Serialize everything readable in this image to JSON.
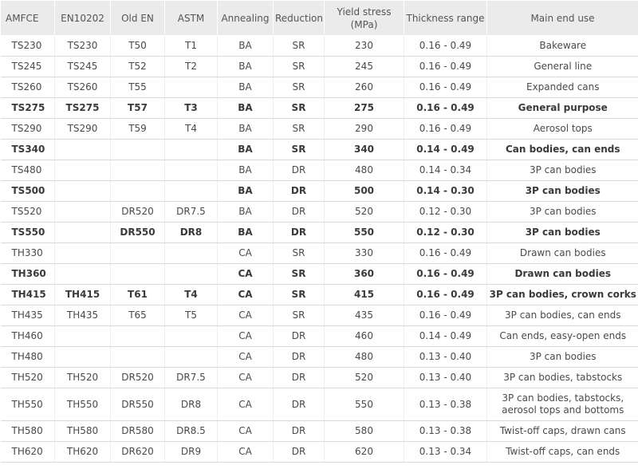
{
  "headers": [
    "AMFCE",
    "EN10202",
    "Old EN",
    "ASTM",
    "Annealing",
    "Reduction",
    "Yield stress (MPa)",
    "Thickness range",
    "Main end use"
  ],
  "rows": [
    [
      "TS230",
      "TS230",
      "T50",
      "T1",
      "BA",
      "SR",
      "230",
      "0.16 - 0.49",
      "Bakeware"
    ],
    [
      "TS245",
      "TS245",
      "T52",
      "T2",
      "BA",
      "SR",
      "245",
      "0.16 - 0.49",
      "General line"
    ],
    [
      "TS260",
      "TS260",
      "T55",
      "",
      "BA",
      "SR",
      "260",
      "0.16 - 0.49",
      "Expanded cans"
    ],
    [
      "TS275",
      "TS275",
      "T57",
      "T3",
      "BA",
      "SR",
      "275",
      "0.16 - 0.49",
      "General purpose"
    ],
    [
      "TS290",
      "TS290",
      "T59",
      "T4",
      "BA",
      "SR",
      "290",
      "0.16 - 0.49",
      "Aerosol tops"
    ],
    [
      "TS340",
      "",
      "",
      "",
      "BA",
      "SR",
      "340",
      "0.14 - 0.49",
      "Can bodies, can ends"
    ],
    [
      "TS480",
      "",
      "",
      "",
      "BA",
      "DR",
      "480",
      "0.14 - 0.34",
      "3P can bodies"
    ],
    [
      "TS500",
      "",
      "",
      "",
      "BA",
      "DR",
      "500",
      "0.14 - 0.30",
      "3P can bodies"
    ],
    [
      "TS520",
      "",
      "DR520",
      "DR7.5",
      "BA",
      "DR",
      "520",
      "0.12 - 0.30",
      "3P can bodies"
    ],
    [
      "TS550",
      "",
      "DR550",
      "DR8",
      "BA",
      "DR",
      "550",
      "0.12 - 0.30",
      "3P can bodies"
    ],
    [
      "TH330",
      "",
      "",
      "",
      "CA",
      "SR",
      "330",
      "0.16 - 0.49",
      "Drawn can bodies"
    ],
    [
      "TH360",
      "",
      "",
      "",
      "CA",
      "SR",
      "360",
      "0.16 - 0.49",
      "Drawn can bodies"
    ],
    [
      "TH415",
      "TH415",
      "T61",
      "T4",
      "CA",
      "SR",
      "415",
      "0.16 - 0.49",
      "3P can bodies, crown corks"
    ],
    [
      "TH435",
      "TH435",
      "T65",
      "T5",
      "CA",
      "SR",
      "435",
      "0.16 - 0.49",
      "3P can bodies, can ends"
    ],
    [
      "TH460",
      "",
      "",
      "",
      "CA",
      "DR",
      "460",
      "0.14 - 0.49",
      "Can ends, easy-open ends"
    ],
    [
      "TH480",
      "",
      "",
      "",
      "CA",
      "DR",
      "480",
      "0.13 - 0.40",
      "3P can bodies"
    ],
    [
      "TH520",
      "TH520",
      "DR520",
      "DR7.5",
      "CA",
      "DR",
      "520",
      "0.13 - 0.40",
      "3P can bodies, tabstocks"
    ],
    [
      "TH550",
      "TH550",
      "DR550",
      "DR8",
      "CA",
      "DR",
      "550",
      "0.13 - 0.38",
      "3P can bodies, tabstocks, aerosol tops and bottoms"
    ],
    [
      "TH580",
      "TH580",
      "DR580",
      "DR8.5",
      "CA",
      "DR",
      "580",
      "0.13 - 0.38",
      "Twist-off caps, drawn cans"
    ],
    [
      "TH620",
      "TH620",
      "DR620",
      "DR9",
      "CA",
      "DR",
      "620",
      "0.13 - 0.34",
      "Twist-off caps, can ends"
    ]
  ],
  "bold_rows": [
    3,
    5,
    7,
    9,
    11,
    12
  ]
}
